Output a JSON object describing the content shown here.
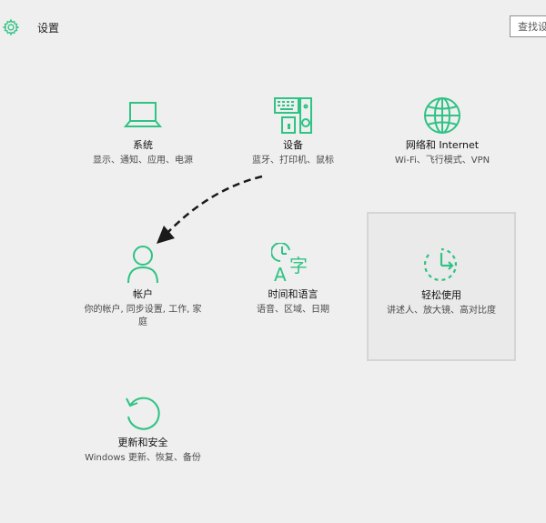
{
  "header": {
    "title": "设置",
    "search_placeholder": "查找设置"
  },
  "tiles": [
    {
      "name": "系统",
      "description": "显示、通知、应用、电源",
      "icon": "laptop-icon"
    },
    {
      "name": "设备",
      "description": "蓝牙、打印机、鼠标",
      "icon": "devices-icon"
    },
    {
      "name": "网络和 Internet",
      "description": "Wi-Fi、飞行模式、VPN",
      "icon": "globe-icon"
    },
    {
      "name": "帐户",
      "description": "你的帐户, 同步设置, 工作, 家庭",
      "icon": "person-icon"
    },
    {
      "name": "时间和语言",
      "description": "语音、区域、日期",
      "icon": "time-language-icon"
    },
    {
      "name": "轻松使用",
      "description": "讲述人、放大镜、高对比度",
      "icon": "ease-of-access-icon"
    },
    {
      "name": "更新和安全",
      "description": "Windows 更新、恢复、备份",
      "icon": "update-icon"
    }
  ],
  "colors": {
    "accent": "#2fc384",
    "background": "#efefef",
    "selected_border": "#d5d5d5"
  }
}
